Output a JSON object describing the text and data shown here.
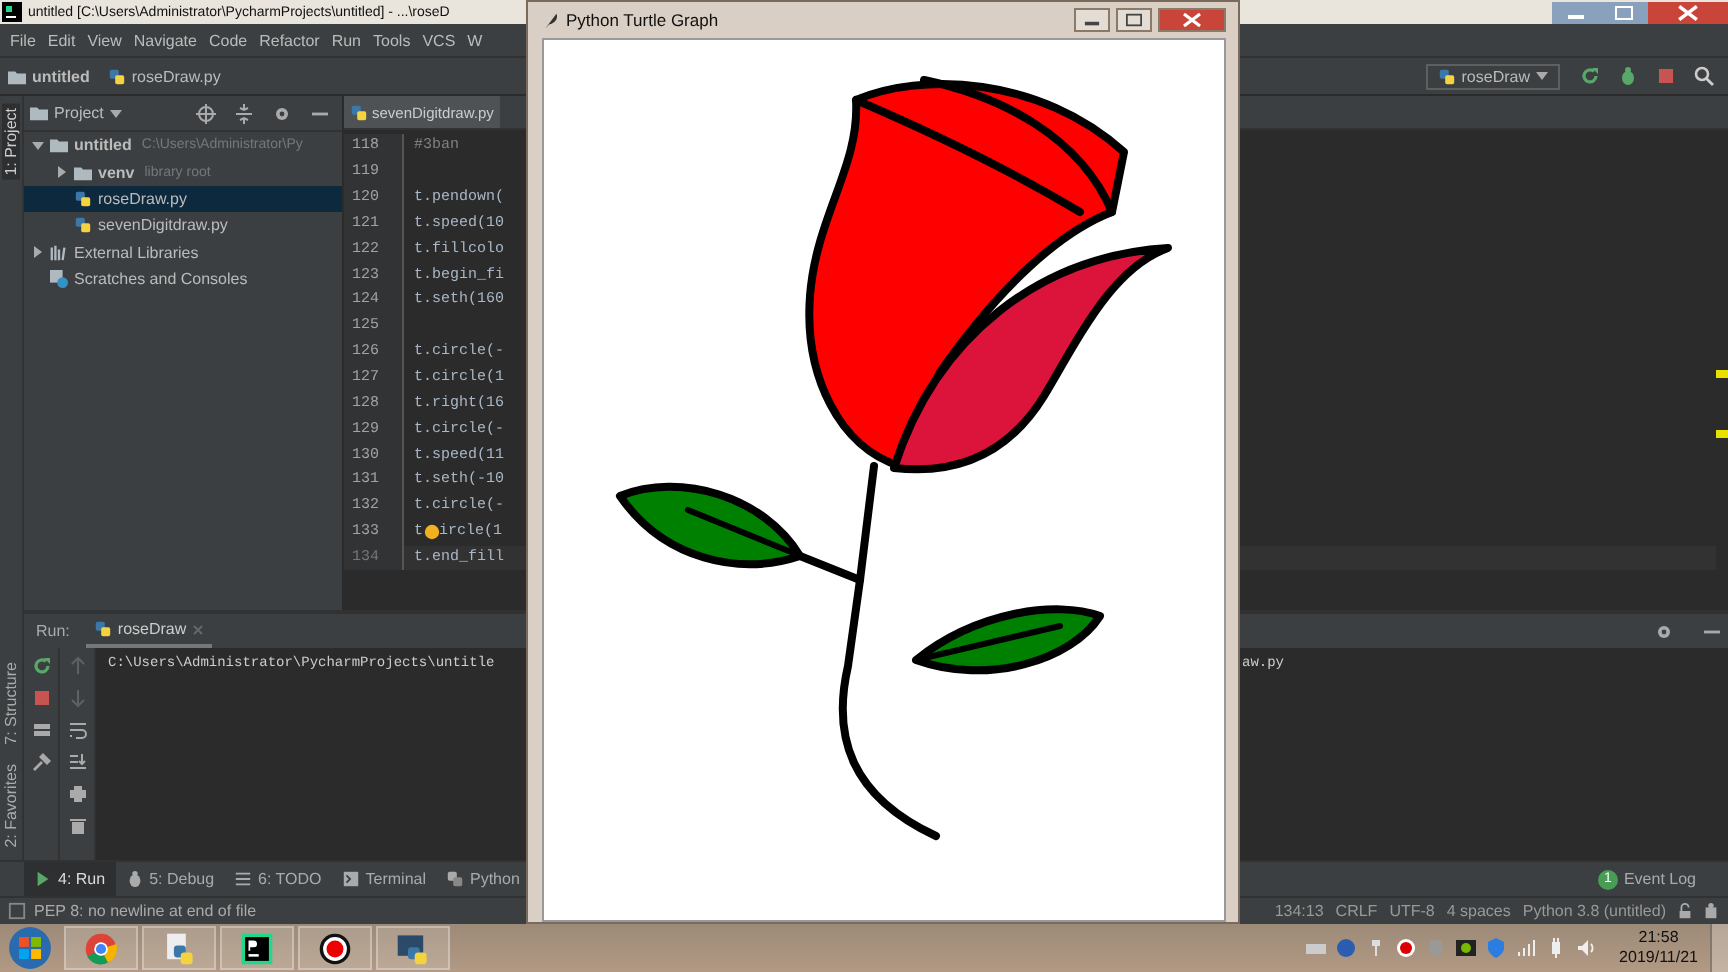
{
  "ide_window": {
    "title": "untitled [C:\\Users\\Administrator\\PycharmProjects\\untitled] - ...\\roseD"
  },
  "menu": [
    "File",
    "Edit",
    "View",
    "Navigate",
    "Code",
    "Refactor",
    "Run",
    "Tools",
    "VCS",
    "W"
  ],
  "breadcrumbs": [
    "untitled",
    "roseDraw.py"
  ],
  "run_config": {
    "label": "roseDraw"
  },
  "side_stripe": {
    "top": [
      {
        "label": "1: Project",
        "selected": true
      }
    ],
    "bottom": [
      {
        "label": "7: Structure",
        "selected": false
      },
      {
        "label": "2: Favorites",
        "selected": false
      }
    ]
  },
  "project_panel": {
    "title": "Project",
    "tree": [
      {
        "label": "untitled",
        "path": "C:\\Users\\Administrator\\Py",
        "kind": "folder",
        "expanded": true,
        "selected": false,
        "children": [
          {
            "label": "venv",
            "path": "library root",
            "kind": "folder",
            "expanded": false,
            "selected": false
          },
          {
            "label": "roseDraw.py",
            "kind": "file",
            "selected": true
          },
          {
            "label": "sevenDigitdraw.py",
            "kind": "file",
            "selected": false
          }
        ]
      },
      {
        "label": "External Libraries",
        "kind": "library",
        "expanded": false,
        "selected": false
      },
      {
        "label": "Scratches and Consoles",
        "kind": "scratch",
        "selected": false
      }
    ]
  },
  "editor": {
    "tab": "sevenDigitdraw.py",
    "lines": [
      {
        "number": "118",
        "kind": "comment",
        "code": "#3ban",
        "current": false
      },
      {
        "number": "119",
        "kind": "blank",
        "current": false
      },
      {
        "number": "120",
        "kind": "code",
        "code": "t.pendown(",
        "current": false
      },
      {
        "number": "121",
        "kind": "code",
        "code": "t.speed(10",
        "current": false
      },
      {
        "number": "122",
        "kind": "code",
        "code": "t.fillcolo",
        "current": false
      },
      {
        "number": "123",
        "kind": "code",
        "code": "t.begin_fi",
        "current": false
      },
      {
        "number": "124",
        "kind": "code",
        "code": "t.seth(160",
        "current": false
      },
      {
        "number": "125",
        "kind": "blank",
        "current": false
      },
      {
        "number": "126",
        "kind": "code",
        "code": "t.circle(-",
        "current": false
      },
      {
        "number": "127",
        "kind": "code",
        "code": "t.circle(1",
        "current": false
      },
      {
        "number": "128",
        "kind": "code",
        "code": "t.right(16",
        "current": false
      },
      {
        "number": "129",
        "kind": "code",
        "code": "t.circle(-",
        "current": false
      },
      {
        "number": "130",
        "kind": "code",
        "code": "t.speed(11",
        "current": false
      },
      {
        "number": "131",
        "kind": "code",
        "code": "t.seth(-10",
        "current": false
      },
      {
        "number": "132",
        "kind": "code",
        "code": "t.circle(-",
        "current": false
      },
      {
        "number": "133",
        "kind": "hint",
        "code": "t",
        "code_after": "ircle(1",
        "current": false
      },
      {
        "number": "134",
        "kind": "code",
        "code": "t.end_fill",
        "current": true
      }
    ]
  },
  "run_panel": {
    "label": "Run:",
    "tab": "roseDraw",
    "output": [
      "C:\\Users\\Administrator\\PycharmProjects\\untitle",
      "aw.py"
    ]
  },
  "tool_tabs": [
    {
      "label": "4: Run",
      "kind": "run",
      "selected": true
    },
    {
      "label": "5: Debug",
      "kind": "debug",
      "selected": false
    },
    {
      "label": "6: TODO",
      "kind": "todo",
      "selected": false
    },
    {
      "label": "Terminal",
      "kind": "terminal",
      "selected": false
    },
    {
      "label": "Python",
      "kind": "python",
      "selected": false
    }
  ],
  "event_log": {
    "count": "1",
    "label": "Event Log"
  },
  "status_bar": {
    "message": "PEP 8: no newline at end of file",
    "items": [
      "134:13",
      "CRLF",
      "UTF-8",
      "4 spaces",
      "Python 3.8 (untitled)"
    ]
  },
  "turtle_window": {
    "title": "Python Turtle Graph"
  },
  "taskbar": {
    "apps": [
      {
        "kind": "chrome"
      },
      {
        "kind": "python-file"
      },
      {
        "kind": "pycharm"
      },
      {
        "kind": "record"
      },
      {
        "kind": "python-idle"
      }
    ],
    "time": "21:58",
    "date": "2019/11/21"
  }
}
